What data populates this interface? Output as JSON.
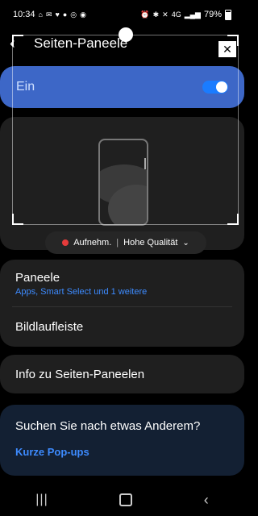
{
  "status_bar": {
    "time": "10:34",
    "battery": "79%",
    "notification_icons": [
      "home-icon",
      "mail-icon",
      "heart-icon",
      "badge-icon",
      "app-icon",
      "signal-icon",
      "app-icon"
    ],
    "system_icons": [
      "alarm-icon",
      "bluetooth-icon",
      "mute-icon",
      "network-icon",
      "wifi-icon",
      "signal-icon"
    ]
  },
  "header": {
    "title": "Seiten-Paneele"
  },
  "toggle": {
    "label": "Ein",
    "state": true
  },
  "recording": {
    "label": "Aufnehm.",
    "quality": "Hohe Qualität"
  },
  "list1": {
    "panels_title": "Paneele",
    "panels_subtitle": "Apps, Smart Select und 1 weitere",
    "scroll_title": "Bildlaufleiste"
  },
  "list2": {
    "info_title": "Info zu Seiten-Paneelen"
  },
  "suggest": {
    "title": "Suchen Sie nach etwas Anderem?",
    "link": "Kurze Pop-ups"
  },
  "colors": {
    "accent": "#3d8bff",
    "toggle_bg": "#3d67c7",
    "record": "#e53b3b"
  }
}
